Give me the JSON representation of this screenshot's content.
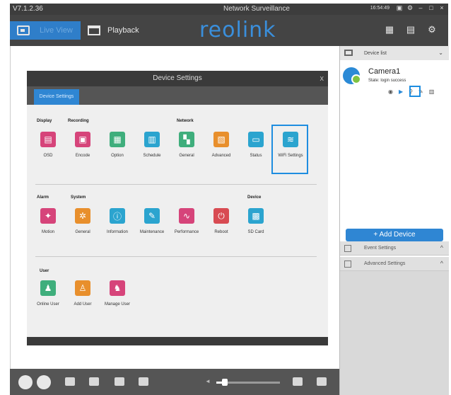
{
  "titlebar": {
    "version": "V7.1.2.36",
    "title": "Network Surveillance",
    "time": "16:54:49"
  },
  "nav": {
    "live_view": "Live View",
    "playback": "Playback",
    "logo": "reolink"
  },
  "dialog": {
    "title": "Device Settings",
    "close": "x",
    "tab": "Device Settings",
    "sections": {
      "display": "Display",
      "recording": "Recording",
      "network": "Network",
      "alarm": "Alarm",
      "system": "System",
      "device": "Device",
      "user": "User"
    },
    "row1": [
      {
        "label": "OSD",
        "icon": "osd-icon",
        "color": "#d6447a",
        "glyph": "▤"
      },
      {
        "label": "Encode",
        "icon": "encode-icon",
        "color": "#d6447a",
        "glyph": "▣"
      },
      {
        "label": "Option",
        "icon": "option-icon",
        "color": "#3fae7c",
        "glyph": "▦"
      },
      {
        "label": "Schedule",
        "icon": "schedule-icon",
        "color": "#2ba4cf",
        "glyph": "▥"
      },
      {
        "label": "General",
        "icon": "general-network-icon",
        "color": "#3fae7c",
        "glyph": "▚"
      },
      {
        "label": "Advanced",
        "icon": "advanced-network-icon",
        "color": "#e88f2c",
        "glyph": "▧"
      },
      {
        "label": "Status",
        "icon": "status-icon",
        "color": "#2ba4cf",
        "glyph": "▭"
      },
      {
        "label": "WiFi Settings",
        "icon": "wifi-icon",
        "color": "#2ba4cf",
        "glyph": "≋"
      }
    ],
    "row2": [
      {
        "label": "Motion",
        "icon": "motion-icon",
        "color": "#d6447a",
        "glyph": "✦"
      },
      {
        "label": "General",
        "icon": "general-system-icon",
        "color": "#e88f2c",
        "glyph": "✲"
      },
      {
        "label": "Information",
        "icon": "information-icon",
        "color": "#2ba4cf",
        "glyph": "ⓘ"
      },
      {
        "label": "Maintenance",
        "icon": "maintenance-icon",
        "color": "#2ba4cf",
        "glyph": "✎"
      },
      {
        "label": "Performance",
        "icon": "performance-icon",
        "color": "#d6447a",
        "glyph": "∿"
      },
      {
        "label": "Reboot",
        "icon": "reboot-icon",
        "color": "#d84b52",
        "glyph": "⏻"
      },
      {
        "label": "SD Card",
        "icon": "sd-card-icon",
        "color": "#2ba4cf",
        "glyph": "▩"
      }
    ],
    "row3": [
      {
        "label": "Online User",
        "icon": "online-user-icon",
        "color": "#3fae7c",
        "glyph": "♟"
      },
      {
        "label": "Add User",
        "icon": "add-user-icon",
        "color": "#e88f2c",
        "glyph": "♙"
      },
      {
        "label": "Manage User",
        "icon": "manage-user-icon",
        "color": "#d6447a",
        "glyph": "♞"
      }
    ]
  },
  "panel": {
    "device_list": "Device list",
    "camera_name": "Camera1",
    "camera_state": "State: login success",
    "add_device": "+ Add Device",
    "event_settings": "Event Settings",
    "advanced_settings": "Advanced Settings"
  }
}
